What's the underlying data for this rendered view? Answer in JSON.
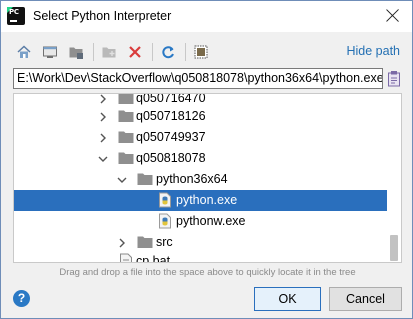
{
  "window": {
    "title": "Select Python Interpreter",
    "app_icon_text": "PC"
  },
  "toolbar": {
    "buttons": [
      "home-icon",
      "desktop-icon",
      "project-folder-icon",
      "new-folder-icon",
      "delete-icon",
      "refresh-icon",
      "show-hidden-icon"
    ],
    "hide_path_label": "Hide path"
  },
  "path": {
    "value": "E:\\Work\\Dev\\StackOverflow\\q050818078\\python36x64\\python.exe"
  },
  "tree": {
    "rows": [
      {
        "label": "q050716470",
        "type": "folder",
        "expanded": false,
        "level": 1
      },
      {
        "label": "q050718126",
        "type": "folder",
        "expanded": false,
        "level": 1
      },
      {
        "label": "q050749937",
        "type": "folder",
        "expanded": false,
        "level": 1
      },
      {
        "label": "q050818078",
        "type": "folder",
        "expanded": true,
        "level": 1
      },
      {
        "label": "python36x64",
        "type": "folder",
        "expanded": true,
        "level": 2
      },
      {
        "label": "python.exe",
        "type": "python-file",
        "selected": true,
        "level": 3
      },
      {
        "label": "pythonw.exe",
        "type": "python-file",
        "selected": false,
        "level": 3
      },
      {
        "label": "src",
        "type": "folder",
        "expanded": false,
        "level": 2
      },
      {
        "label": "cp.bat",
        "type": "file",
        "level": 1
      }
    ]
  },
  "hint": "Drag and drop a file into the space above to quickly locate it in the tree",
  "footer": {
    "help_glyph": "?",
    "ok_label": "OK",
    "cancel_label": "Cancel"
  },
  "colors": {
    "selection": "#2a6fbd",
    "link": "#2470b3",
    "folder": "#8f8f8f",
    "python_blue": "#3d7ab8"
  }
}
